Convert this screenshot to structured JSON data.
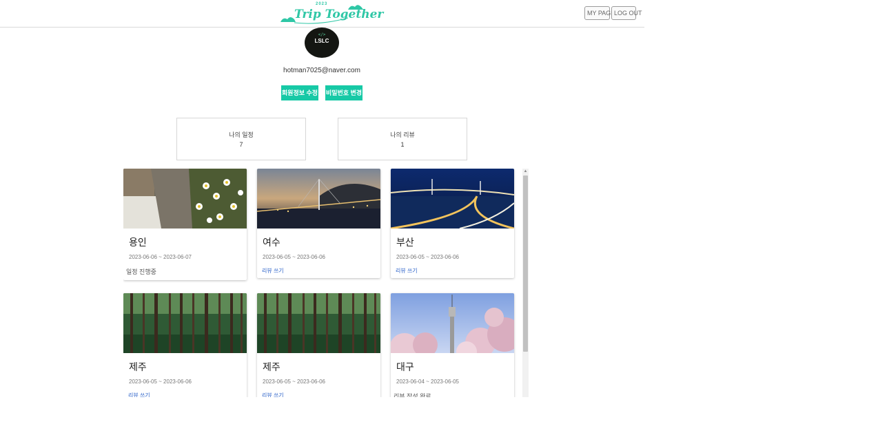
{
  "header": {
    "logo_text": "Trip Together",
    "logo_year": "2023",
    "my_page_label": "MY PAGE",
    "logout_label": "LOG OUT"
  },
  "profile": {
    "avatar_text": "LSLC",
    "avatar_code": "</>",
    "email": "hotman7025@naver.com",
    "edit_info_label": "회원정보 수정",
    "change_password_label": "비밀번호 변경"
  },
  "stats": {
    "schedule_label": "나의 일정",
    "schedule_count": "7",
    "review_label": "나의 리뷰",
    "review_count": "1"
  },
  "accent_color": "#17c9a6",
  "cards": [
    {
      "title": "용인",
      "dates": "2023-06-06 ~ 2023-06-07",
      "status": "일정 진행중",
      "image": "daisy-wall-photo"
    },
    {
      "title": "여수",
      "dates": "2023-06-05 ~ 2023-06-06",
      "action": "리뷰 쓰기",
      "image": "bridge-night-photo"
    },
    {
      "title": "부산",
      "dates": "2023-06-05 ~ 2023-06-06",
      "action": "리뷰 쓰기",
      "image": "gwangan-bridge-photo"
    },
    {
      "title": "제주",
      "dates": "2023-06-05 ~ 2023-06-06",
      "action": "리뷰 쓰기",
      "image": "forest-photo"
    },
    {
      "title": "제주",
      "dates": "2023-06-05 ~ 2023-06-06",
      "action": "리뷰 쓰기",
      "image": "forest-photo"
    },
    {
      "title": "대구",
      "dates": "2023-06-04 ~ 2023-06-05",
      "status": "리뷰 작성 완료",
      "image": "tower-blossom-photo"
    }
  ]
}
